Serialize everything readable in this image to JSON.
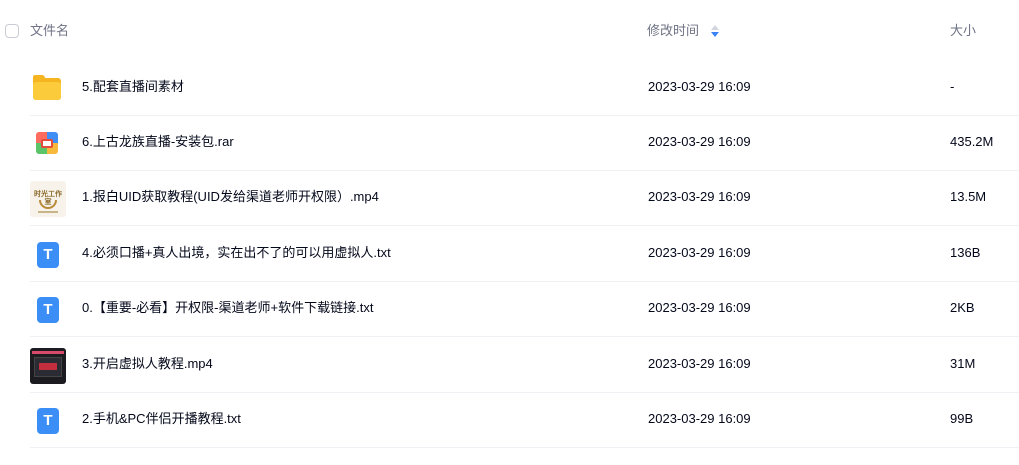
{
  "header": {
    "name_label": "文件名",
    "time_label": "修改时间",
    "size_label": "大小",
    "sort_icon": "sort-desc-icon",
    "accent_color": "#3b82f6"
  },
  "files": [
    {
      "name": "5.配套直播间素材",
      "time": "2023-03-29 16:09",
      "size": "-",
      "icon": "folder-icon"
    },
    {
      "name": "6.上古龙族直播-安装包.rar",
      "time": "2023-03-29 16:09",
      "size": "435.2M",
      "icon": "rar-archive-icon"
    },
    {
      "name": "1.报白UID获取教程(UID发给渠道老师开权限）.mp4",
      "time": "2023-03-29 16:09",
      "size": "13.5M",
      "icon": "video-thumbnail",
      "thumb_text": "时光工作室"
    },
    {
      "name": "4.必须口播+真人出境，实在出不了的可以用虚拟人.txt",
      "time": "2023-03-29 16:09",
      "size": "136B",
      "icon": "txt-file-icon",
      "glyph": "T"
    },
    {
      "name": "0.【重要-必看】开权限-渠道老师+软件下载链接.txt",
      "time": "2023-03-29 16:09",
      "size": "2KB",
      "icon": "txt-file-icon",
      "glyph": "T"
    },
    {
      "name": "3.开启虚拟人教程.mp4",
      "time": "2023-03-29 16:09",
      "size": "31M",
      "icon": "video-thumbnail"
    },
    {
      "name": "2.手机&PC伴侣开播教程.txt",
      "time": "2023-03-29 16:09",
      "size": "99B",
      "icon": "txt-file-icon",
      "glyph": "T"
    }
  ]
}
